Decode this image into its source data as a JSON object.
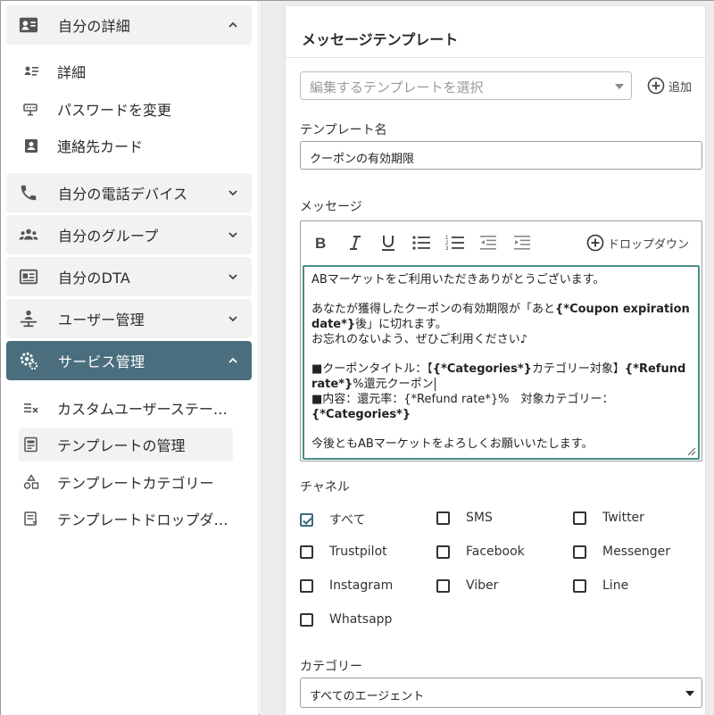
{
  "sidebar": {
    "sections": [
      {
        "label": "自分の詳細",
        "icon": "contact-card-icon",
        "expanded": true
      },
      {
        "label": "自分の電話デバイス",
        "icon": "phone-icon",
        "expanded": false
      },
      {
        "label": "自分のグループ",
        "icon": "group-icon",
        "expanded": false
      },
      {
        "label": "自分のDTA",
        "icon": "dta-card-icon",
        "expanded": false
      },
      {
        "label": "ユーザー管理",
        "icon": "user-admin-icon",
        "expanded": false
      },
      {
        "label": "サービス管理",
        "icon": "service-gear-icon",
        "expanded": true,
        "active": true
      }
    ],
    "details_items": [
      {
        "label": "詳細",
        "icon": "details-list-icon"
      },
      {
        "label": "パスワードを変更",
        "icon": "password-icon"
      },
      {
        "label": "連絡先カード",
        "icon": "contact-icon"
      }
    ],
    "service_items": [
      {
        "label": "カスタムユーザーステータス",
        "icon": "custom-status-icon"
      },
      {
        "label": "テンプレートの管理",
        "icon": "template-manage-icon",
        "selected": true
      },
      {
        "label": "テンプレートカテゴリー",
        "icon": "template-category-icon"
      },
      {
        "label": "テンプレートドロップダウン",
        "icon": "template-dropdown-icon"
      }
    ]
  },
  "main": {
    "title": "メッセージテンプレート",
    "template_select": {
      "placeholder": "編集するテンプレートを選択"
    },
    "add_label": "追加",
    "template_name": {
      "label": "テンプレート名",
      "value": "クーポンの有効期限"
    },
    "message": {
      "label": "メッセージ",
      "dropdown_label": "ドロップダウン",
      "lines": {
        "l1": "ABマーケットをご利用いただきありがとうございます。",
        "l2a": "あなたが獲得したクーポンの有効期限が「あと",
        "l2b": "{*Coupon expiration date*}",
        "l2c": "後」に切れます。",
        "l3": "お忘れのないよう、ぜひご利用ください♪",
        "l4a": "■クーポンタイトル：【",
        "l4b": "{*Categories*}",
        "l4c": "カテゴリー対象】",
        "l4d": "{*Refund rate*}",
        "l4e": "%還元クーポン",
        "l5a": "■内容：還元率：{*Refund rate*}%　対象カテゴリー：",
        "l5b": "{*Categories*}",
        "l6": "今後ともABマーケットをよろしくお願いいたします。"
      }
    },
    "channel": {
      "label": "チャネル",
      "options": [
        {
          "label": "すべて",
          "checked": true
        },
        {
          "label": "SMS",
          "checked": false
        },
        {
          "label": "Twitter",
          "checked": false
        },
        {
          "label": "Trustpilot",
          "checked": false
        },
        {
          "label": "Facebook",
          "checked": false
        },
        {
          "label": "Messenger",
          "checked": false
        },
        {
          "label": "Instagram",
          "checked": false
        },
        {
          "label": "Viber",
          "checked": false
        },
        {
          "label": "Line",
          "checked": false
        },
        {
          "label": "Whatsapp",
          "checked": false
        }
      ]
    },
    "category": {
      "label": "カテゴリー",
      "value": "すべてのエージェント"
    }
  },
  "colors": {
    "accent": "#4a6e7e",
    "editor_focus": "#4a8f8a",
    "check": "#3a6b7d"
  }
}
